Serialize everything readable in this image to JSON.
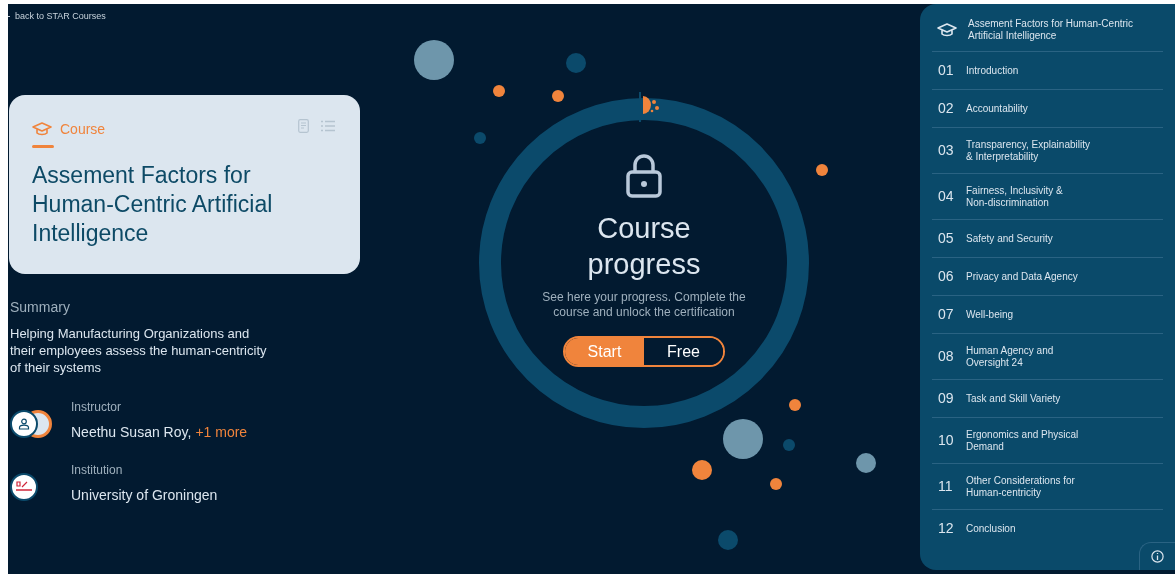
{
  "back_link": {
    "label": "back to STAR Courses"
  },
  "course_card": {
    "kind_label": "Course",
    "title": "Assement Factors for Human-Centric Artificial Intelligence"
  },
  "summary": {
    "heading": "Summary",
    "text": "Helping Manufacturing Organizations and their employees assess the human-centricity of their systems"
  },
  "instructor": {
    "label": "Instructor",
    "name": "Neethu Susan Roy,",
    "more": "+1 more"
  },
  "institution": {
    "label": "Institution",
    "name": "University of Groningen"
  },
  "progress": {
    "title": "Course progress",
    "description": "See here your progress. Complete the course and unlock the certification",
    "toggle": [
      {
        "label": "Start",
        "selected": true
      },
      {
        "label": "Free",
        "selected": false
      }
    ]
  },
  "sidebar": {
    "course_title": "Assement Factors for Human-Centric Artificial Intelligence",
    "items": [
      {
        "number": "01",
        "label": "Introduction"
      },
      {
        "number": "02",
        "label": "Accountability"
      },
      {
        "number": "03",
        "label": "Transparency, Explainability\n& Interpretability"
      },
      {
        "number": "04",
        "label": "Fairness, Inclusivity &\nNon-discrimination"
      },
      {
        "number": "05",
        "label": "Safety and Security"
      },
      {
        "number": "06",
        "label": "Privacy and Data Agency"
      },
      {
        "number": "07",
        "label": "Well-being"
      },
      {
        "number": "08",
        "label": "Human Agency and\nOversight 24"
      },
      {
        "number": "09",
        "label": "Task and Skill Variety"
      },
      {
        "number": "10",
        "label": "Ergonomics and Physical\nDemand"
      },
      {
        "number": "11",
        "label": "Other Considerations for\nHuman-centricity"
      },
      {
        "number": "12",
        "label": "Conclusion"
      }
    ]
  }
}
